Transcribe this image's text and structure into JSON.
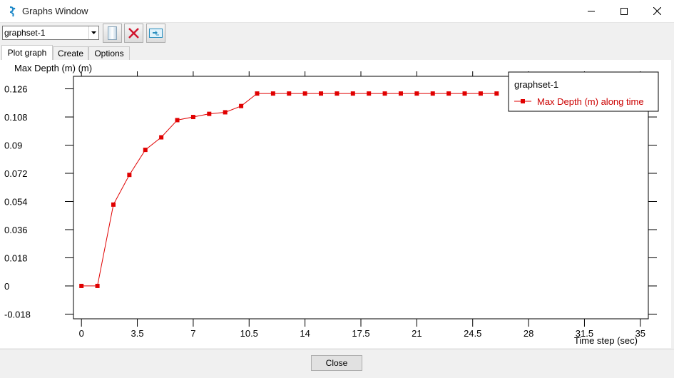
{
  "window": {
    "title": "Graphs Window"
  },
  "toolbar": {
    "graphset_selected": "graphset-1"
  },
  "tabs": [
    {
      "label": "Plot graph",
      "active": true
    },
    {
      "label": "Create",
      "active": false
    },
    {
      "label": "Options",
      "active": false
    }
  ],
  "footer": {
    "close_label": "Close"
  },
  "colors": {
    "series": "#e00000",
    "legend_text": "#cc0000"
  },
  "chart_data": {
    "type": "line",
    "title": "",
    "ylabel": "Max Depth (m)  (m)",
    "xlabel": "Time step (sec)",
    "legend_title": "graphset-1",
    "legend_placement": "top-right",
    "grid": false,
    "xlim": [
      -0.5,
      35.5
    ],
    "ylim": [
      -0.021,
      0.134
    ],
    "x_ticks": [
      0,
      3.5,
      7,
      10.5,
      14,
      17.5,
      21,
      24.5,
      28,
      31.5,
      35
    ],
    "y_ticks": [
      -0.018,
      0,
      0.018,
      0.036,
      0.054,
      0.072,
      0.09,
      0.108,
      0.126
    ],
    "series": [
      {
        "name": "Max Depth (m) along time",
        "x": [
          0,
          1,
          2,
          3,
          4,
          5,
          6,
          7,
          8,
          9,
          10,
          11,
          12,
          13,
          14,
          15,
          16,
          17,
          18,
          19,
          20,
          21,
          22,
          23,
          24,
          25,
          26
        ],
        "y": [
          0,
          0,
          0.052,
          0.071,
          0.087,
          0.095,
          0.106,
          0.108,
          0.11,
          0.111,
          0.115,
          0.123,
          0.123,
          0.123,
          0.123,
          0.123,
          0.123,
          0.123,
          0.123,
          0.123,
          0.123,
          0.123,
          0.123,
          0.123,
          0.123,
          0.123,
          0.123
        ]
      }
    ]
  }
}
